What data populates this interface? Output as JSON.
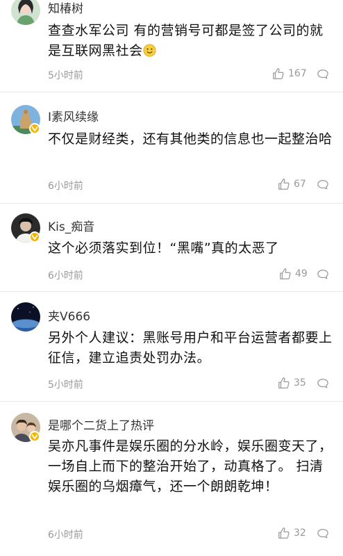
{
  "comments": [
    {
      "username": "知椿树",
      "content": "查查水军公司 有的营销号可都是签了公司的就是互联网黑社会",
      "emoji": "smile",
      "time": "5小时前",
      "likes": "167",
      "verified": false
    },
    {
      "username": "I素风续缘",
      "content": "不仅是财经类，还有其他类的信息也一起整治哈",
      "time": "6小时前",
      "likes": "67",
      "verified": true
    },
    {
      "username": "Kis_痴音",
      "content": "这个必须落实到位！“黑嘴”真的太恶了",
      "time": "6小时前",
      "likes": "49",
      "verified": true
    },
    {
      "username": "夹V666",
      "content": "另外个人建议：黑账号用户和平台运营者都要上征信，建立追责处罚办法。",
      "time": "5小时前",
      "likes": "35",
      "verified": false
    },
    {
      "username": "是哪个二货上了热评",
      "content": "吴亦凡事件是娱乐圈的分水岭，娱乐圈变天了，一场自上而下的整治开始了，动真格了。 扫清娱乐圈的乌烟瘴气，还一个朗朗乾坤！",
      "time": "6小时前",
      "likes": "32",
      "verified": true
    }
  ],
  "icons": {
    "like": "thumbs-up-icon",
    "reply": "comment-bubble-icon",
    "verified": "verified-badge-icon"
  },
  "colors": {
    "verified_badge": "#f5b500",
    "meta_text": "#999999"
  }
}
